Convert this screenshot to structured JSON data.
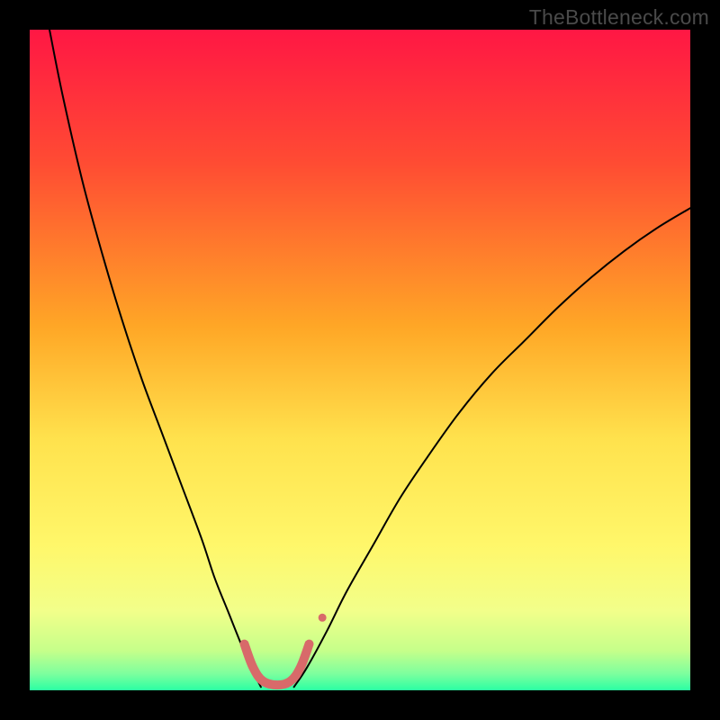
{
  "watermark": "TheBottleneck.com",
  "chart_data": {
    "type": "line",
    "title": "",
    "xlabel": "",
    "ylabel": "",
    "xlim": [
      0,
      100
    ],
    "ylim": [
      0,
      100
    ],
    "grid": false,
    "legend": false,
    "gradient_bg": {
      "stops": [
        {
          "offset": 0.0,
          "color": "#ff1744"
        },
        {
          "offset": 0.2,
          "color": "#ff4b33"
        },
        {
          "offset": 0.45,
          "color": "#ffa726"
        },
        {
          "offset": 0.62,
          "color": "#ffe24d"
        },
        {
          "offset": 0.78,
          "color": "#fff76a"
        },
        {
          "offset": 0.88,
          "color": "#f2ff8a"
        },
        {
          "offset": 0.94,
          "color": "#c6ff8a"
        },
        {
          "offset": 0.975,
          "color": "#7dff9e"
        },
        {
          "offset": 1.0,
          "color": "#2bffa3"
        }
      ]
    },
    "series": [
      {
        "name": "left-arm",
        "stroke": "#000000",
        "stroke_width": 2,
        "x": [
          3,
          5,
          8,
          11,
          14,
          17,
          20,
          23,
          26,
          28,
          30,
          32,
          33.5,
          35
        ],
        "y": [
          100,
          90,
          77,
          66,
          56,
          47,
          39,
          31,
          23,
          17,
          12,
          7,
          3.5,
          0.5
        ]
      },
      {
        "name": "right-arm",
        "stroke": "#000000",
        "stroke_width": 2,
        "x": [
          40,
          42,
          45,
          48,
          52,
          56,
          60,
          65,
          70,
          75,
          80,
          85,
          90,
          95,
          100
        ],
        "y": [
          0.5,
          3.5,
          9,
          15,
          22,
          29,
          35,
          42,
          48,
          53,
          58,
          62.5,
          66.5,
          70,
          73
        ]
      },
      {
        "name": "valley-marker",
        "type": "marker-band",
        "stroke": "#d86a6a",
        "stroke_width": 10,
        "linecap": "round",
        "points": [
          {
            "x": 32.5,
            "y": 7.0
          },
          {
            "x": 33.8,
            "y": 3.5
          },
          {
            "x": 35.3,
            "y": 1.4
          },
          {
            "x": 37.5,
            "y": 0.8
          },
          {
            "x": 39.5,
            "y": 1.4
          },
          {
            "x": 41.0,
            "y": 3.5
          },
          {
            "x": 42.3,
            "y": 7.0
          }
        ],
        "extra_dot": {
          "x": 44.3,
          "y": 11.0,
          "r": 4.5
        }
      }
    ]
  }
}
